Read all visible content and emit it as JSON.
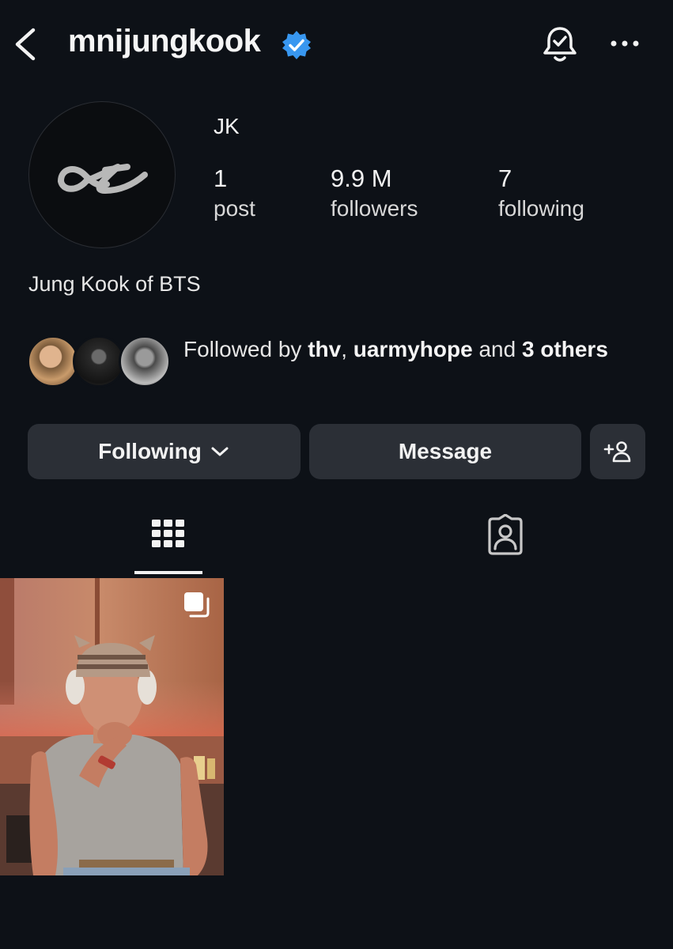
{
  "header": {
    "username": "mnijungkook",
    "verified": true,
    "icons": {
      "back": "chevron-left-icon",
      "verified": "verified-badge-icon",
      "notifications": "bell-check-icon",
      "more": "more-horizontal-icon"
    }
  },
  "profile": {
    "display_name": "JK",
    "stats": [
      {
        "value": "1",
        "label": "post"
      },
      {
        "value": "9.9 M",
        "label": "followers"
      },
      {
        "value": "7",
        "label": "following"
      }
    ],
    "bio": "Jung Kook of BTS",
    "followed_by": {
      "prefix": "Followed by ",
      "users": [
        "thv",
        "uarmyhope"
      ],
      "sep": ", ",
      "and": " and ",
      "others_count": "3",
      "others_suffix": "others"
    }
  },
  "actions": {
    "following_label": "Following",
    "message_label": "Message"
  },
  "tabs": [
    {
      "icon": "grid-icon",
      "active": true
    },
    {
      "icon": "tagged-person-icon",
      "active": false
    }
  ],
  "posts": [
    {
      "type": "carousel",
      "icon": "multiple-photos-icon"
    }
  ],
  "colors": {
    "background": "#0d1117",
    "button": "#2b2f36",
    "verified": "#3897f0",
    "text": "#f2f2f2"
  }
}
